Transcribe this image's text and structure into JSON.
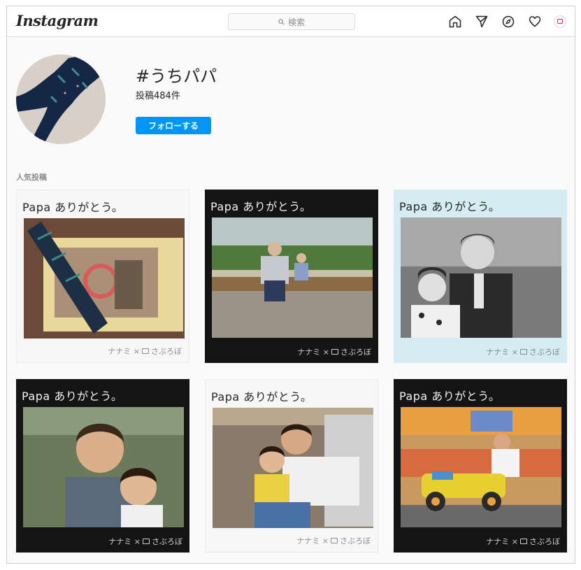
{
  "header": {
    "logo": "Instagram",
    "search_placeholder": "検索",
    "icons": [
      "home-icon",
      "direct-icon",
      "explore-icon",
      "activity-heart-icon",
      "profile-avatar"
    ]
  },
  "hashtag": {
    "title": "#うちパパ",
    "post_count": "投稿484件",
    "follow_label": "フォローする"
  },
  "section": {
    "label": "人気投稿"
  },
  "posts": [
    {
      "caption": "Papa ありがとう。",
      "credit_left": "ナナミ ×",
      "credit_right": "さぶろぼ",
      "style": "light"
    },
    {
      "caption": "Papa ありがとう。",
      "credit_left": "ナナミ ×",
      "credit_right": "さぶろぼ",
      "style": "dark"
    },
    {
      "caption": "Papa ありがとう。",
      "credit_left": "ナナミ ×",
      "credit_right": "さぶろぼ",
      "style": "blue"
    },
    {
      "caption": "Papa ありがとう。",
      "credit_left": "ナナミ ×",
      "credit_right": "さぶろぼ",
      "style": "dark"
    },
    {
      "caption": "Papa ありがとう。",
      "credit_left": "ナナミ ×",
      "credit_right": "さぶろぼ",
      "style": "light"
    },
    {
      "caption": "Papa ありがとう。",
      "credit_left": "ナナミ ×",
      "credit_right": "さぶろぼ",
      "style": "dark"
    }
  ],
  "colors": {
    "accent": "#0095f6",
    "border": "#dbdbdb",
    "background": "#fafafa"
  }
}
